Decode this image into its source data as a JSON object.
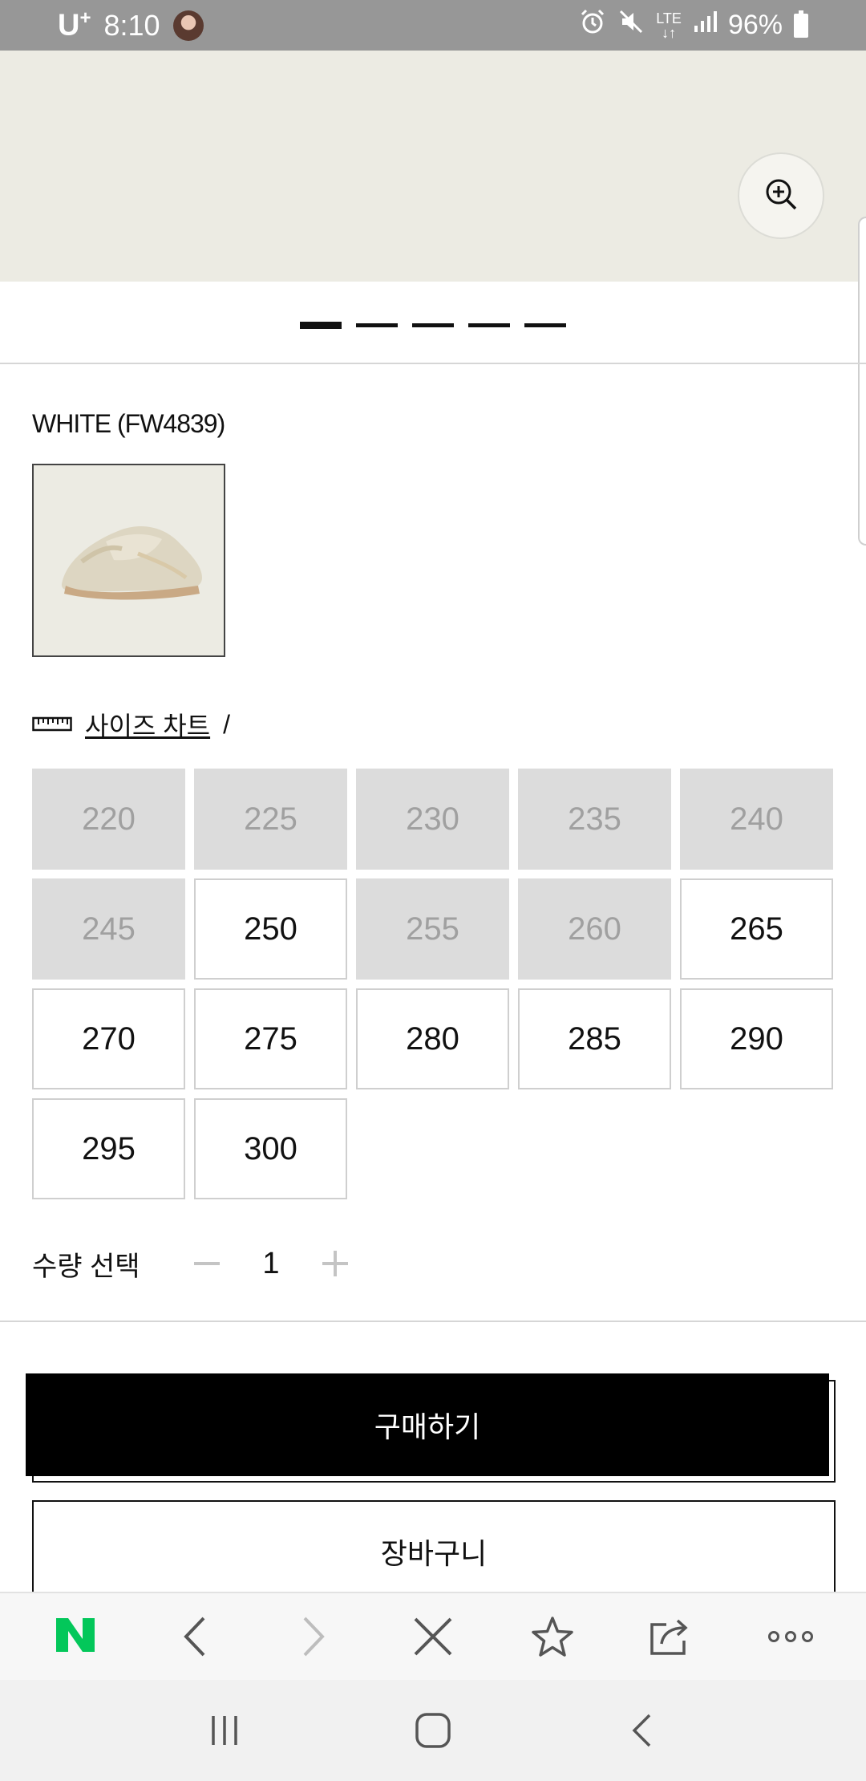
{
  "status_bar": {
    "carrier": "U",
    "carrier_sup": "+",
    "time": "8:10",
    "network": "LTE",
    "battery": "96%"
  },
  "hero": {
    "zoom_icon": "zoom-in-icon",
    "pager": {
      "count": 5,
      "active_index": 0
    }
  },
  "product": {
    "color_label": "WHITE (FW4839)"
  },
  "size_chart": {
    "icon": "ruler-icon",
    "link_label": "사이즈 차트",
    "separator": "/"
  },
  "sizes": [
    {
      "label": "220",
      "available": false
    },
    {
      "label": "225",
      "available": false
    },
    {
      "label": "230",
      "available": false
    },
    {
      "label": "235",
      "available": false
    },
    {
      "label": "240",
      "available": false
    },
    {
      "label": "245",
      "available": false
    },
    {
      "label": "250",
      "available": true
    },
    {
      "label": "255",
      "available": false
    },
    {
      "label": "260",
      "available": false
    },
    {
      "label": "265",
      "available": true
    },
    {
      "label": "270",
      "available": true
    },
    {
      "label": "275",
      "available": true
    },
    {
      "label": "280",
      "available": true
    },
    {
      "label": "285",
      "available": true
    },
    {
      "label": "290",
      "available": true
    },
    {
      "label": "295",
      "available": true
    },
    {
      "label": "300",
      "available": true
    }
  ],
  "quantity": {
    "label": "수량 선택",
    "value": "1",
    "minus_icon": "minus-icon",
    "plus_icon": "plus-icon"
  },
  "actions": {
    "buy_label": "구매하기",
    "cart_label": "장바구니"
  },
  "browser_toolbar": {
    "items": [
      "naver-logo-icon",
      "back-arrow-icon",
      "forward-arrow-icon",
      "close-icon",
      "star-icon",
      "share-icon",
      "more-icon"
    ],
    "naver_letter": "N",
    "accent_color": "#03c75a"
  },
  "system_nav": {
    "items": [
      "recent-apps-icon",
      "home-icon",
      "back-icon"
    ]
  }
}
